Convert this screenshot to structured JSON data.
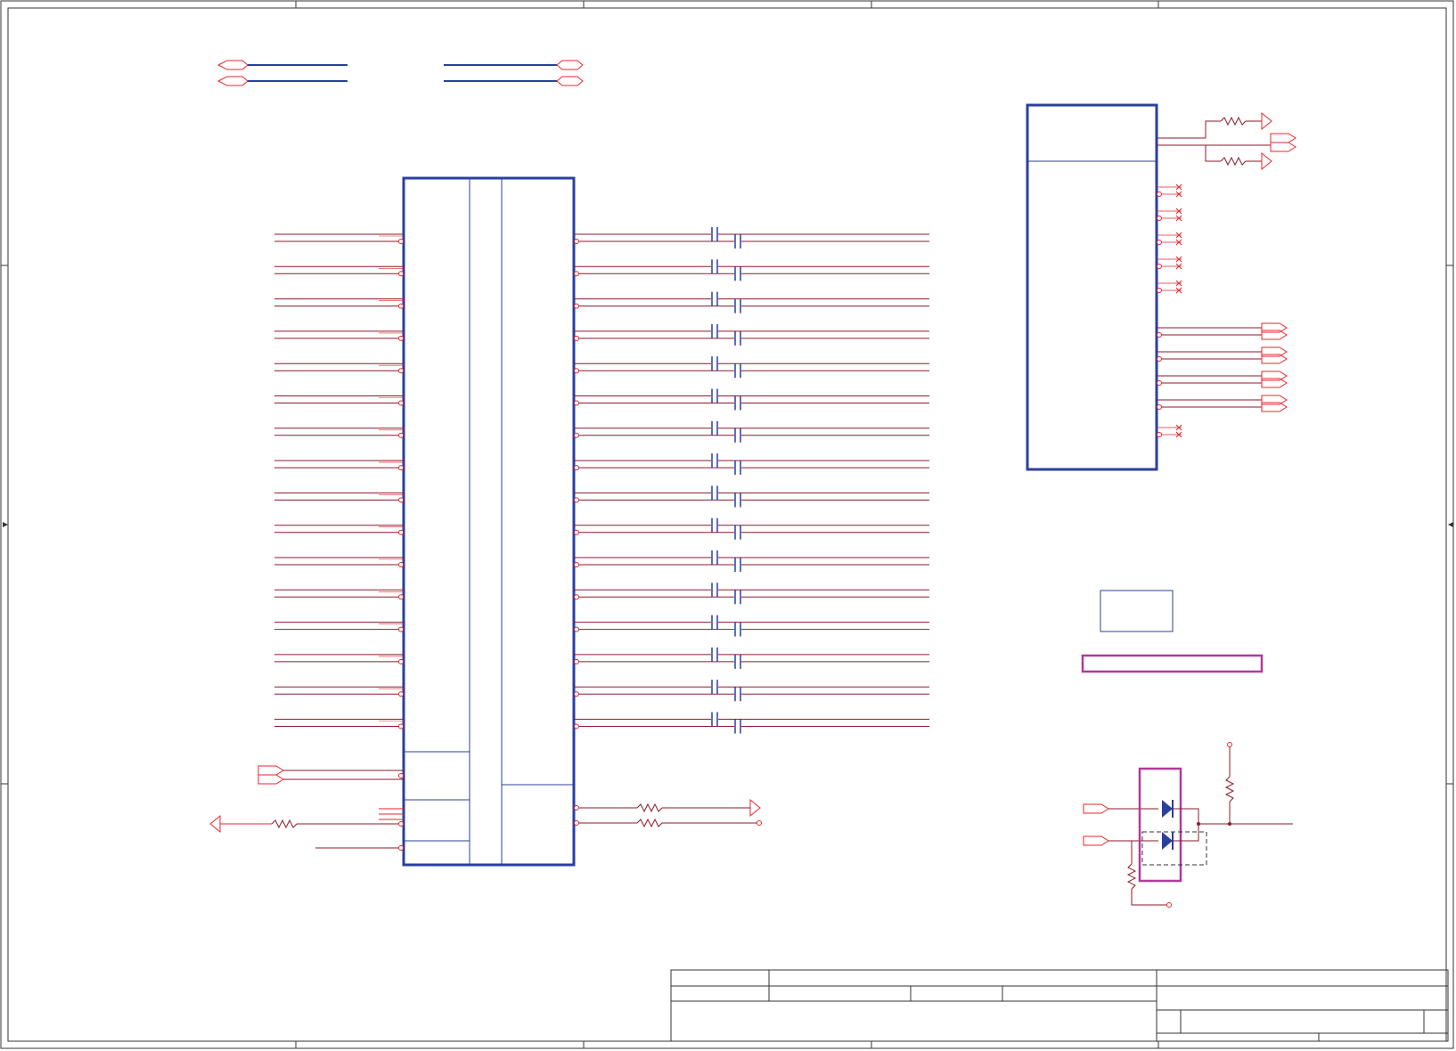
{
  "colors": {
    "wire": "#e8262b",
    "net": "#8b1a2b",
    "component": "#2a3f9e",
    "highlight": "#b23a9a",
    "frame": "#333333"
  },
  "icons": {
    "offpage_connector": "diamond-arrow-icon",
    "resistor": "zigzag-resistor-icon",
    "capacitor": "parallel-plate-capacitor-icon",
    "no_connect": "x-mark-icon",
    "diode": "diode-icon",
    "ground_arrow": "triangle-arrow-icon"
  },
  "schematic": {
    "left_pairs": 16,
    "right_pairs": 16,
    "ic_right_output_ports": 4,
    "ic_right_nc_pins": 6,
    "title_block_text": []
  }
}
